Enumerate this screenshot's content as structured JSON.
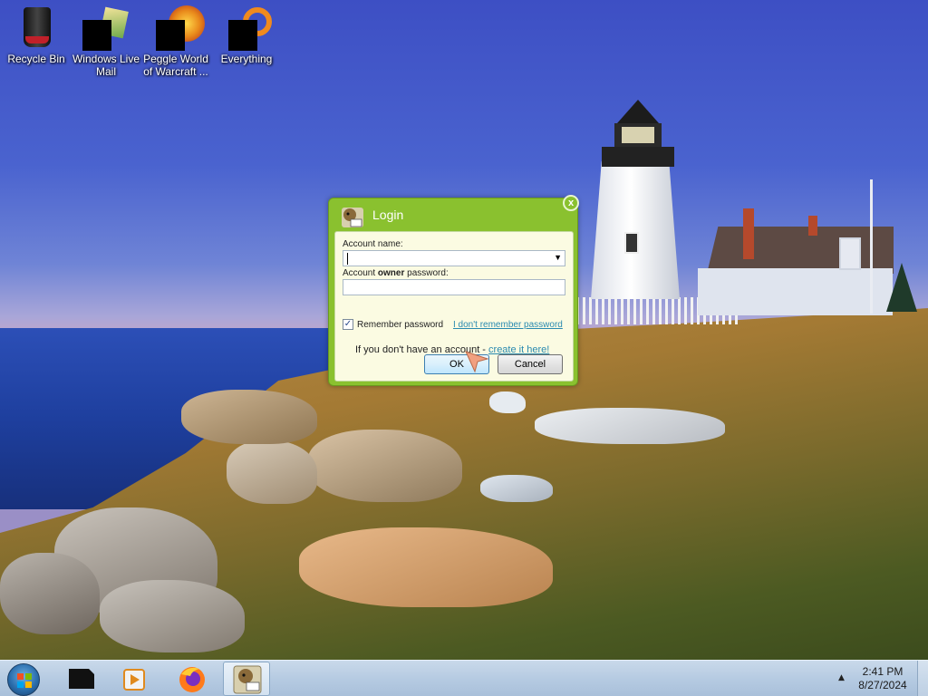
{
  "desktop": {
    "icons": [
      {
        "label": "Recycle Bin",
        "icon": "recycle-bin-icon"
      },
      {
        "label": "Windows Live Mail",
        "icon": "windows-live-mail-icon"
      },
      {
        "label": "Peggle World of Warcraft ...",
        "icon": "peggle-icon"
      },
      {
        "label": "Everything",
        "icon": "everything-search-icon"
      }
    ]
  },
  "dialog": {
    "title": "Login",
    "close_glyph": "x",
    "account_name_label": "Account name:",
    "account_name_value": "",
    "password_label_prefix": "Account ",
    "password_label_bold": "owner",
    "password_label_suffix": " password:",
    "password_value": "",
    "remember_label": "Remember password",
    "remember_checked": true,
    "forgot_link": "I don't remember password",
    "no_account_text": "If you don't have an account - ",
    "create_link": "create it here!",
    "ok_label": "OK",
    "cancel_label": "Cancel",
    "accent_color": "#8ac12f"
  },
  "taskbar": {
    "start_icon": "windows-start-orb-icon",
    "pinned": [
      {
        "icon": "black-app-icon"
      },
      {
        "icon": "media-player-icon"
      },
      {
        "icon": "firefox-icon"
      },
      {
        "icon": "box-app-icon",
        "active": true
      }
    ],
    "clock_time": "2:41 PM",
    "clock_date": "8/27/2024"
  }
}
